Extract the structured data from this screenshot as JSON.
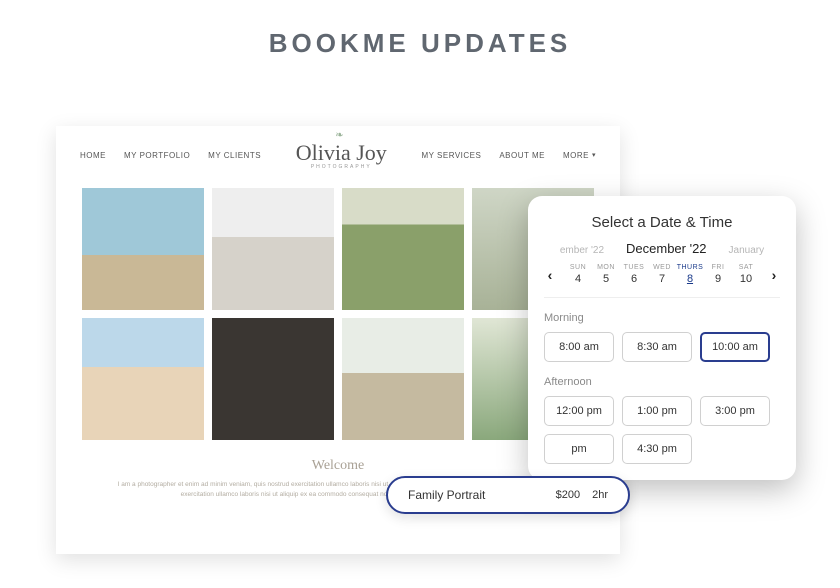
{
  "page_heading": "BOOKME UPDATES",
  "site": {
    "nav_left": [
      "HOME",
      "MY PORTFOLIO",
      "MY CLIENTS"
    ],
    "nav_right": [
      "MY SERVICES",
      "ABOUT ME"
    ],
    "nav_more": "MORE",
    "logo_main": "Olivia Joy",
    "logo_sub": "PHOTOGRAPHY",
    "welcome_title": "Welcome",
    "welcome_body": "I am a photographer et enim ad minim veniam, quis nostrud exercitation ullamco laboris nisi ut aliquip ex ea commodo consequat aute irure. Quis nostrud exercitation ullamco laboris nisi ut aliquip ex ea commodo consequat nostrud exercitation ullamco laboris nisi."
  },
  "booking": {
    "title": "Select a Date & Time",
    "months": {
      "prev": "ember '22",
      "current": "December '22",
      "next": "January"
    },
    "days": [
      {
        "abbr": "SUN",
        "num": "4"
      },
      {
        "abbr": "MON",
        "num": "5"
      },
      {
        "abbr": "TUES",
        "num": "6"
      },
      {
        "abbr": "WED",
        "num": "7"
      },
      {
        "abbr": "THURS",
        "num": "8",
        "selected": true
      },
      {
        "abbr": "FRI",
        "num": "9"
      },
      {
        "abbr": "SAT",
        "num": "10"
      }
    ],
    "morning_label": "Morning",
    "morning_slots": [
      {
        "t": "8:00 am"
      },
      {
        "t": "8:30 am"
      },
      {
        "t": "10:00 am",
        "selected": true
      }
    ],
    "afternoon_label": "Afternoon",
    "afternoon_slots": [
      {
        "t": "12:00 pm"
      },
      {
        "t": "1:00 pm"
      },
      {
        "t": "3:00 pm"
      },
      {
        "t": "pm"
      },
      {
        "t": "4:30 pm"
      }
    ]
  },
  "service": {
    "name": "Family Portrait",
    "price": "$200",
    "duration": "2hr"
  }
}
